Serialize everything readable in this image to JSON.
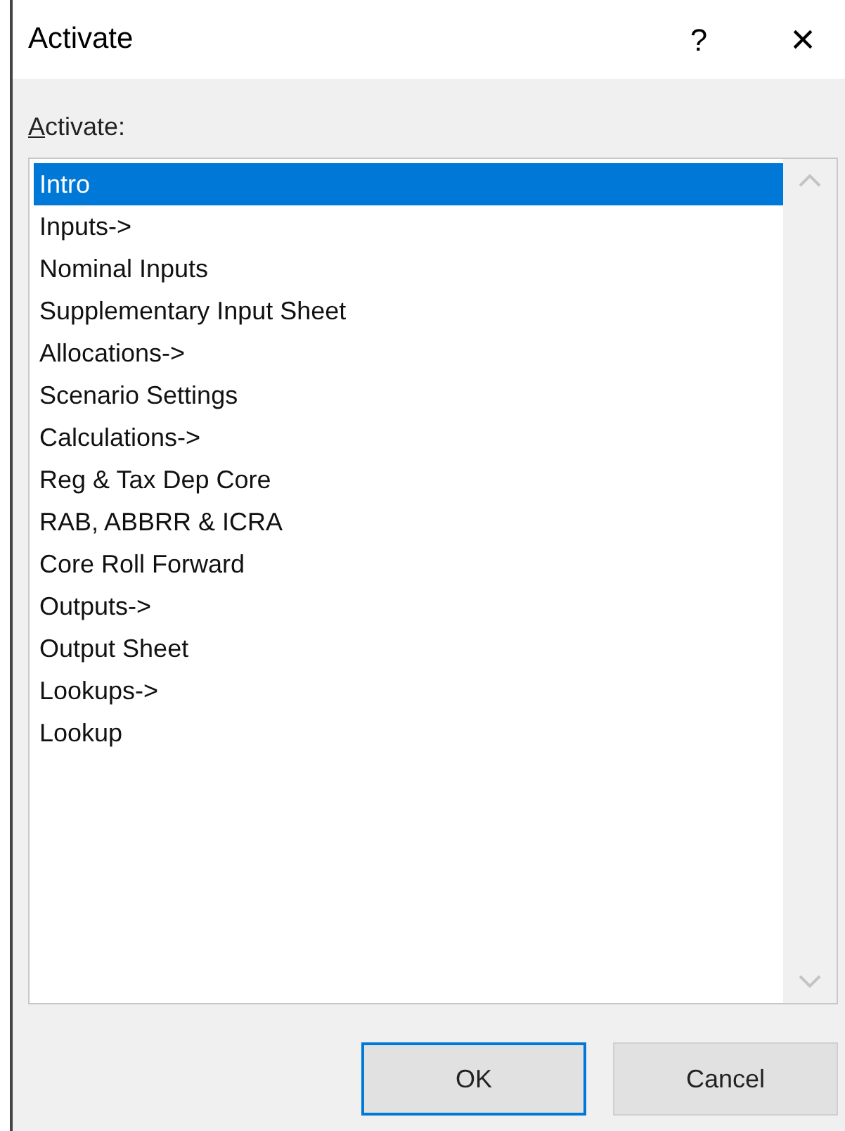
{
  "window": {
    "title": "Activate",
    "help": "?",
    "close": "×"
  },
  "list_label": {
    "text": "Activate:",
    "first_letter_underlined": true
  },
  "items": [
    {
      "label": "Intro",
      "selected": true
    },
    {
      "label": "Inputs->",
      "selected": false
    },
    {
      "label": "Nominal Inputs",
      "selected": false
    },
    {
      "label": "Supplementary Input Sheet",
      "selected": false
    },
    {
      "label": "Allocations->",
      "selected": false
    },
    {
      "label": "Scenario Settings",
      "selected": false
    },
    {
      "label": "Calculations->",
      "selected": false
    },
    {
      "label": "Reg & Tax Dep Core",
      "selected": false
    },
    {
      "label": "RAB, ABBRR & ICRA",
      "selected": false
    },
    {
      "label": "Core Roll Forward",
      "selected": false
    },
    {
      "label": "Outputs->",
      "selected": false
    },
    {
      "label": "Output Sheet",
      "selected": false
    },
    {
      "label": "Lookups->",
      "selected": false
    },
    {
      "label": "Lookup",
      "selected": false
    }
  ],
  "buttons": [
    {
      "label": "OK",
      "default": true
    },
    {
      "label": "Cancel",
      "default": false
    }
  ]
}
